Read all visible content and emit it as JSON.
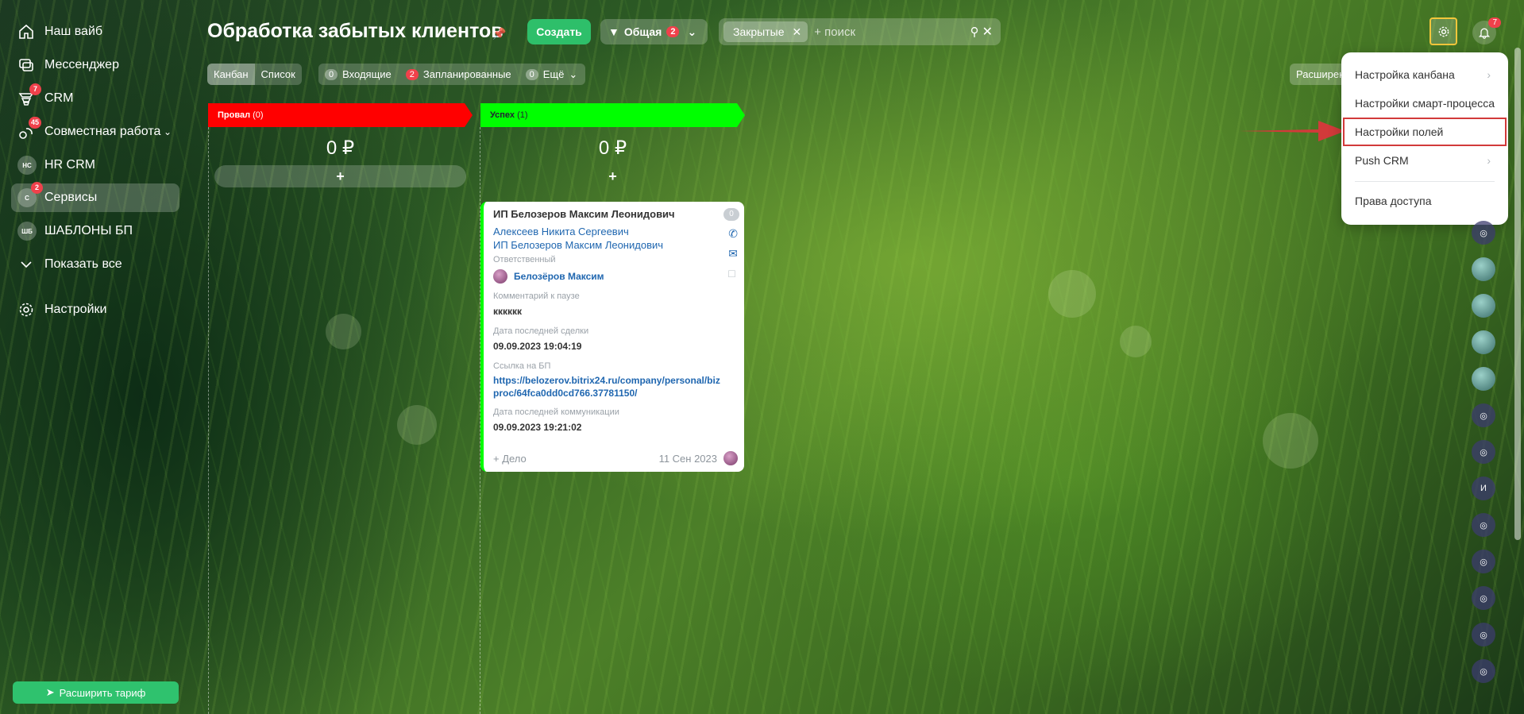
{
  "sidebar": {
    "items": [
      {
        "label": "Наш вайб",
        "icon": "home-icon"
      },
      {
        "label": "Мессенджер",
        "icon": "chat-icon"
      },
      {
        "label": "CRM",
        "icon": "crm-icon",
        "badge": "7"
      },
      {
        "label": "Совместная работа",
        "icon": "collab-icon",
        "badge": "45"
      },
      {
        "label": "HR CRM",
        "abbr": "HC"
      },
      {
        "label": "Сервисы",
        "abbr": "С",
        "badge": "2"
      },
      {
        "label": "ШАБЛОНЫ БП",
        "abbr": "ШБ"
      },
      {
        "label": "Показать все"
      },
      {
        "label": "Настройки",
        "icon": "gear-icon"
      }
    ],
    "upgrade_label": "Расширить тариф"
  },
  "header": {
    "title": "Обработка забытых клиентов",
    "create_label": "Создать",
    "pipeline_label": "Общая",
    "pipeline_badge": "2",
    "filter_tag": "Закрытые",
    "search_placeholder": "+ поиск",
    "notifications_badge": "7"
  },
  "subheader": {
    "view_kanban": "Канбан",
    "view_list": "Список",
    "incoming_count": "0",
    "incoming_label": "Входящие",
    "planned_count": "2",
    "planned_label": "Запланированные",
    "more_count": "0",
    "more_label": "Ещё",
    "extensions_label": "Расширения"
  },
  "columns": [
    {
      "name": "Провал",
      "count": "(0)",
      "sum": "0 ₽",
      "color": "#ff0000"
    },
    {
      "name": "Успех",
      "count": "(1)",
      "sum": "0 ₽",
      "color": "#00ff00"
    }
  ],
  "card": {
    "title": "ИП Белозеров Максим Леонидович",
    "counter": "0",
    "contact": "Алексеев Никита Сергеевич",
    "company": "ИП Белозеров Максим Леонидович",
    "responsible_label": "Ответственный",
    "responsible_name": "Белозёров Максим",
    "comment_label": "Комментарий к паузе",
    "comment_value": "кккккк",
    "last_deal_label": "Дата последней сделки",
    "last_deal_value": "09.09.2023 19:04:19",
    "bp_link_label": "Ссылка на БП",
    "bp_link_value": "https://belozerov.bitrix24.ru/company/personal/bizproc/64fca0dd0cd766.37781150/",
    "last_comm_label": "Дата последней коммуникации",
    "last_comm_value": "09.09.2023 19:21:02",
    "add_task_label": "+ Дело",
    "date": "11 Сен 2023"
  },
  "menu": {
    "items": [
      {
        "label": "Настройка канбана",
        "submenu": true
      },
      {
        "label": "Настройки смарт-процесса",
        "submenu": false
      },
      {
        "label": "Настройки полей",
        "submenu": false,
        "highlighted": true
      },
      {
        "label": "Push CRM",
        "submenu": true
      },
      {
        "label": "Права доступа",
        "submenu": false
      }
    ]
  },
  "rail": {
    "letter": "И"
  },
  "colors": {
    "accent_green": "#2ebf6a",
    "badge_red": "#f0414b",
    "highlight_yellow": "#f3c63b",
    "annotation_red": "#d23a3a"
  }
}
